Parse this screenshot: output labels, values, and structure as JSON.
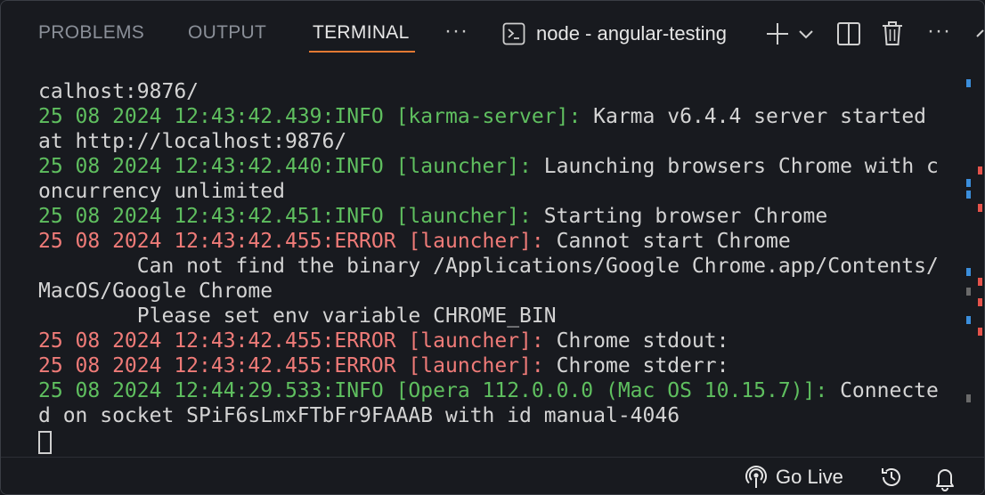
{
  "tabs": [
    {
      "label": "PROBLEMS",
      "active": false
    },
    {
      "label": "OUTPUT",
      "active": false
    },
    {
      "label": "TERMINAL",
      "active": true
    }
  ],
  "toolbar": {
    "terminal_name": "node - angular-testing",
    "icons": [
      "more-icon",
      "terminal-icon",
      "plus-icon",
      "chevron-down-icon",
      "split-icon",
      "trash-icon",
      "more-icon",
      "chevron-up-icon"
    ]
  },
  "terminal": {
    "lines": [
      {
        "ts": "",
        "level": "",
        "text": "calhost:9876/"
      },
      {
        "ts": "25 08 2024 12:43:42.439:",
        "level": "INFO [karma-server]:",
        "text": " Karma v6.4.4 server started"
      },
      {
        "ts": "",
        "level": "",
        "text": "at http://localhost:9876/"
      },
      {
        "ts": "25 08 2024 12:43:42.440:",
        "level": "INFO [launcher]:",
        "text": " Launching browsers Chrome with c"
      },
      {
        "ts": "",
        "level": "",
        "text": "oncurrency unlimited"
      },
      {
        "ts": "25 08 2024 12:43:42.451:",
        "level": "INFO [launcher]:",
        "text": " Starting browser Chrome"
      },
      {
        "ts": "25 08 2024 12:43:42.455:",
        "level": "ERROR [launcher]:",
        "text": " Cannot start Chrome"
      },
      {
        "ts": "",
        "level": "",
        "text": "        Can not find the binary /Applications/Google Chrome.app/Contents/"
      },
      {
        "ts": "",
        "level": "",
        "text": "MacOS/Google Chrome"
      },
      {
        "ts": "",
        "level": "",
        "text": "        Please set env variable CHROME_BIN"
      },
      {
        "ts": "25 08 2024 12:43:42.455:",
        "level": "ERROR [launcher]:",
        "text": " Chrome stdout:"
      },
      {
        "ts": "25 08 2024 12:43:42.455:",
        "level": "ERROR [launcher]:",
        "text": " Chrome stderr:"
      },
      {
        "ts": "25 08 2024 12:44:29.533:",
        "level": "INFO [Opera 112.0.0.0 (Mac OS 10.15.7)]:",
        "text": " Connecte"
      },
      {
        "ts": "",
        "level": "",
        "text": "d on socket SPiF6sLmxFTbFr9FAAAB with id manual-4046"
      }
    ]
  },
  "status_bar": {
    "go_live_label": "Go Live",
    "icons": [
      "broadcast-icon",
      "history-icon",
      "bell-icon"
    ]
  },
  "colors": {
    "background": "#181a1f",
    "info": "#5fbf5f",
    "error": "#ef7b78",
    "text": "#d4d4d4",
    "tab_active_underline": "#e37933"
  }
}
